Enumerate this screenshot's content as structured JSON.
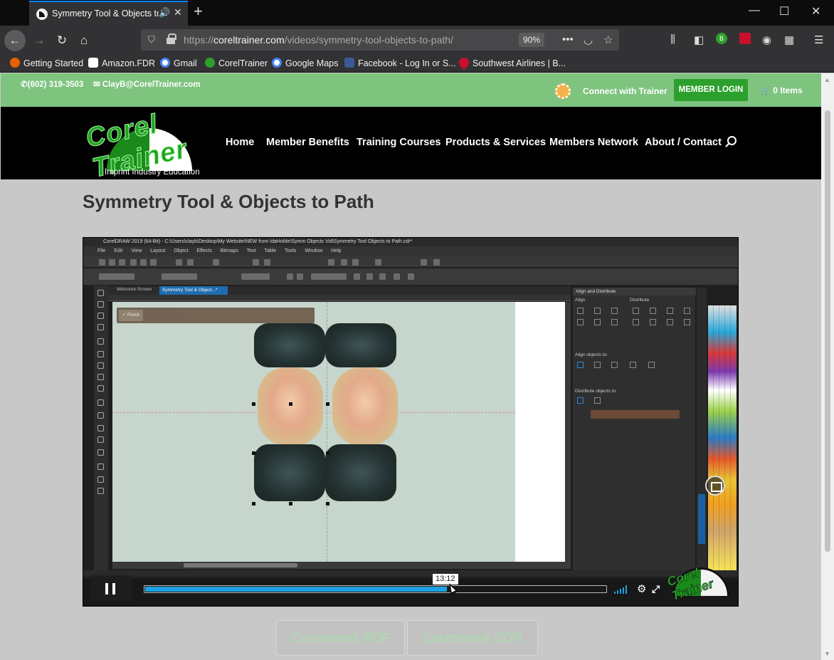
{
  "browser": {
    "tab_title": "Symmetry Tool & Objects to Path",
    "url_domain": "coreltrainer.com",
    "url_prefix": "https://",
    "url_path": "/videos/symmetry-tool-objects-to-path/",
    "zoom": "90%",
    "bookmarks": [
      {
        "label": "Getting Started",
        "icon": "firefox-icon",
        "color": "#e66000"
      },
      {
        "label": "Amazon.FDR",
        "icon": "amazon-icon",
        "color": "#ffffff"
      },
      {
        "label": "Gmail",
        "icon": "google-icon",
        "color": "#4285f4"
      },
      {
        "label": "CorelTrainer",
        "icon": "coreltrainer-icon",
        "color": "#2ca02c"
      },
      {
        "label": "Google Maps",
        "icon": "google-icon",
        "color": "#4285f4"
      },
      {
        "label": "Facebook - Log In or S...",
        "icon": "facebook-icon",
        "color": "#3b5998"
      },
      {
        "label": "Southwest Airlines | B...",
        "icon": "heart-icon",
        "color": "#c8102e"
      }
    ]
  },
  "site": {
    "phone": "(602) 319-3503",
    "email": "ClayB@CorelTrainer.com",
    "connect": "Connect with Trainer",
    "login": "MEMBER LOGIN",
    "cart": "0 Items",
    "logo_text": "Corel Trainer",
    "logo_tagline": "Imprint Industry Education",
    "nav": [
      "Home",
      "Member Benefits",
      "Training Courses",
      "Products & Services",
      "Members Network",
      "About / Contact"
    ],
    "accent": "#7ec47f",
    "button_green": "#2ca02c"
  },
  "page": {
    "title": "Symmetry Tool & Objects to Path"
  },
  "video": {
    "app_title": "CorelDRAW 2019 (64-Bit) - C:\\Users\\clayb\\Desktop\\My Website\\NEW from IdaHoMe\\Symm Objects Vid\\Symmetry Tool Objects to Path.cdr*",
    "menu": [
      "File",
      "Edit",
      "View",
      "Layout",
      "Object",
      "Effects",
      "Bitmaps",
      "Text",
      "Table",
      "Tools",
      "Window",
      "Help"
    ],
    "doc_tab_welcome": "Welcome Screen",
    "doc_tab_active": "Symmetry Tool & Object...*",
    "finish_label": "Finish",
    "panel_title": "Align and Distribute",
    "panel_align": "Align",
    "panel_distribute": "Distribute",
    "panel_align_to": "Align objects to:",
    "panel_distribute_to": "Distribute objects to:",
    "time": "13:12",
    "progress": 0.656,
    "watermark": "Corel Trainer"
  },
  "coursework": {
    "pdf": "Coursework PDF",
    "cdr": "Coursework CDR"
  }
}
